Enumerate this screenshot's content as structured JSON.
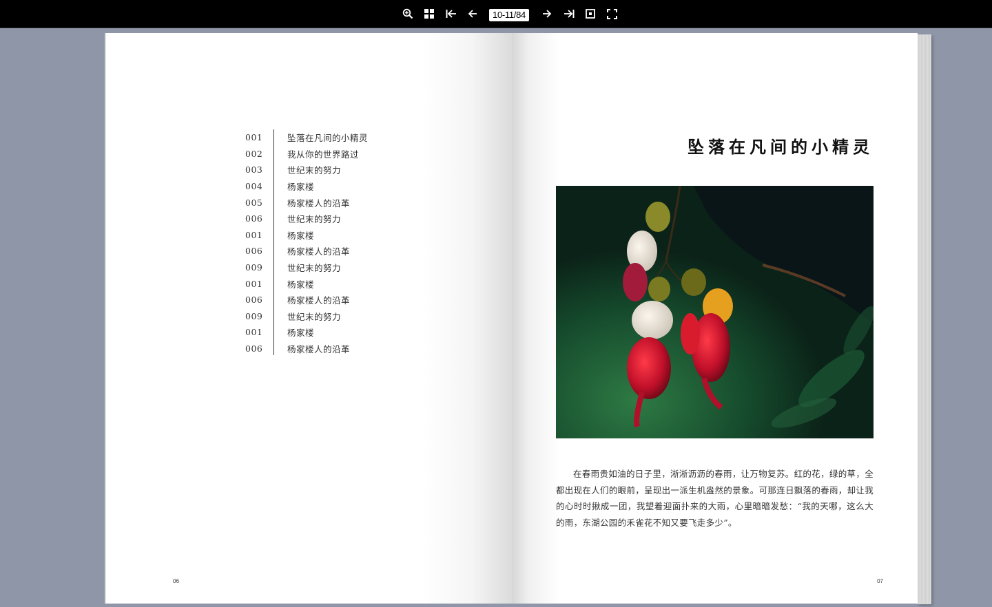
{
  "toolbar": {
    "page_indicator": "10-11/84",
    "icons": [
      "zoom-in-icon",
      "thumbnails-icon",
      "first-page-icon",
      "previous-page-icon",
      "next-page-icon",
      "last-page-icon",
      "single-page-icon",
      "fullscreen-icon"
    ]
  },
  "left_page": {
    "toc": [
      {
        "num": "001",
        "title": "坠落在凡间的小精灵"
      },
      {
        "num": "002",
        "title": "我从你的世界路过"
      },
      {
        "num": "003",
        "title": "世纪末的努力"
      },
      {
        "num": "004",
        "title": "杨家楼"
      },
      {
        "num": "005",
        "title": "杨家楼人的沿革"
      },
      {
        "num": "006",
        "title": "世纪末的努力"
      },
      {
        "num": "001",
        "title": "杨家楼"
      },
      {
        "num": "006",
        "title": "杨家楼人的沿革"
      },
      {
        "num": "009",
        "title": "世纪末的努力"
      },
      {
        "num": "001",
        "title": "杨家楼"
      },
      {
        "num": "006",
        "title": "杨家楼人的沿革"
      },
      {
        "num": "009",
        "title": "世纪末的努力"
      },
      {
        "num": "001",
        "title": "杨家楼"
      },
      {
        "num": "006",
        "title": "杨家楼人的沿革"
      }
    ],
    "page_number": "06"
  },
  "right_page": {
    "chapter_title": "坠落在凡间的小精灵",
    "body": "在春雨贵如油的日子里，淅淅沥沥的春雨，让万物复苏。红的花，绿的草，全都出现在人们的眼前，呈现出一派生机盎然的景象。可那连日飘落的春雨，却让我的心时时揪成一团，我望着迎面扑来的大雨，心里暗暗发愁：“我的天哪，这么大的雨，东湖公园的禾雀花不知又要飞走多少”。",
    "page_number": "07"
  },
  "colors": {
    "toolbar_bg": "#000000",
    "viewer_bg": "#8e96a8",
    "page_bg": "#ffffff"
  }
}
